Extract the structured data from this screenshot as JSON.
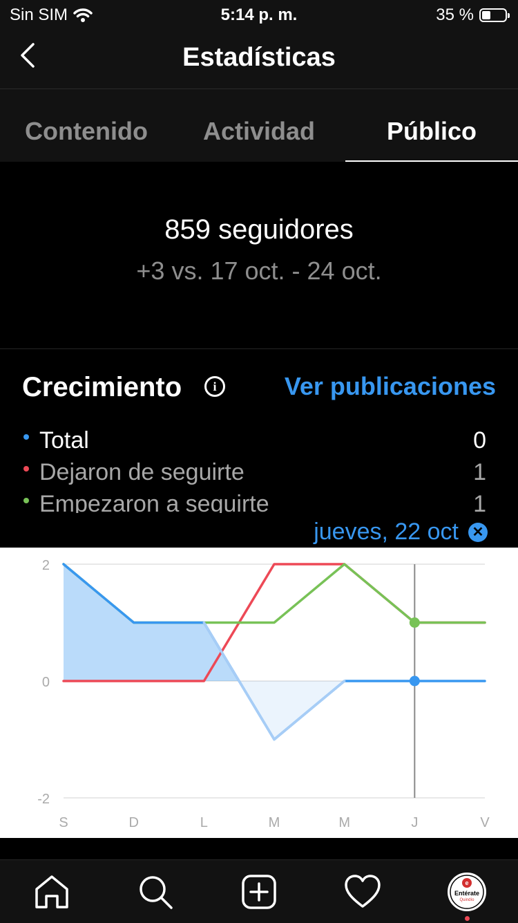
{
  "status_bar": {
    "carrier": "Sin SIM",
    "time": "5:14 p. m.",
    "battery": "35 %",
    "battery_level": 0.35
  },
  "nav": {
    "title": "Estadísticas"
  },
  "tabs": [
    {
      "label": "Contenido",
      "active": false
    },
    {
      "label": "Actividad",
      "active": false
    },
    {
      "label": "Público",
      "active": true
    }
  ],
  "summary": {
    "followers": "859 seguidores",
    "delta": "+3 vs. 17 oct. - 24 oct."
  },
  "growth": {
    "title": "Crecimiento",
    "link": "Ver publicaciones",
    "legend": [
      {
        "label": "Total",
        "value": "0",
        "color": "#3897f0"
      },
      {
        "label": "Dejaron de seguirte",
        "value": "1",
        "color": "#ed4956"
      },
      {
        "label": "Empezaron a seguirte",
        "value": "1",
        "color": "#78c257"
      }
    ],
    "selected_date": "jueves, 22 oct"
  },
  "chart_data": {
    "type": "line",
    "categories": [
      "S",
      "D",
      "L",
      "M",
      "M",
      "J",
      "V"
    ],
    "yticks": [
      "2",
      "0",
      "-2"
    ],
    "ylim": [
      -2,
      2
    ],
    "selected_index": 5,
    "series": [
      {
        "name": "Total",
        "color": "#3897f0",
        "values": [
          2,
          1,
          1,
          -1,
          0,
          0,
          0
        ]
      },
      {
        "name": "Dejaron de seguirte",
        "color": "#ed4956",
        "values": [
          0,
          0,
          0,
          2,
          2,
          1,
          1
        ]
      },
      {
        "name": "Empezaron a seguirte",
        "color": "#78c257",
        "values": [
          2,
          1,
          1,
          1,
          2,
          1,
          1
        ]
      }
    ]
  },
  "tab_bar": {
    "items": [
      "home-icon",
      "search-icon",
      "create-icon",
      "heart-icon",
      "profile-avatar"
    ],
    "avatar_text": "Entérate",
    "avatar_sub": "Quindío"
  }
}
